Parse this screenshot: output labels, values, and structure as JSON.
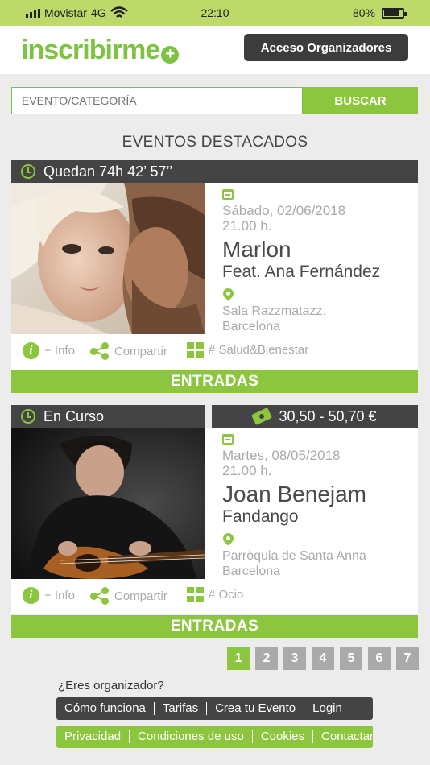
{
  "status_bar": {
    "carrier": "Movistar",
    "network": "4G",
    "time": "22:10",
    "battery": "80%",
    "battery_level": 0.8
  },
  "header": {
    "logo_text": "inscribirme",
    "logo_plus": "+",
    "organizers_button": "Acceso Organizadores"
  },
  "search": {
    "placeholder": "EVENTO/CATEGORÍA",
    "button": "BUSCAR"
  },
  "section_title": "EVENTOS DESTACADOS",
  "events": [
    {
      "status": "Quedan 74h 42’ 57’’",
      "date": "Sábado, 02/06/2018",
      "time": "21.00 h.",
      "artist": "Marlon",
      "subtitle": "Feat. Ana Fernández",
      "venue_line1": "Sala Razzmatazz.",
      "venue_line2": "Barcelona",
      "info_label": "+ Info",
      "share_label": "Compartir",
      "category": "# Salud&Bienestar",
      "tickets_button": "ENTRADAS"
    },
    {
      "status": "En Curso",
      "price": "30,50 - 50,70 €",
      "date": "Martes, 08/05/2018",
      "time": "21.00 h.",
      "artist": "Joan Benejam",
      "subtitle": "Fandango",
      "venue_line1": "Parròquia de Santa Anna",
      "venue_line2": "Barcelona",
      "info_label": "+ Info",
      "share_label": "Compartir",
      "category": "# Ocio",
      "tickets_button": "ENTRADAS"
    }
  ],
  "pagination": {
    "pages": [
      "1",
      "2",
      "3",
      "4",
      "5",
      "6",
      "7"
    ],
    "current": "1"
  },
  "footer": {
    "question": "¿Eres organizador?",
    "dark_links": [
      "Cómo funciona",
      "Tarifas",
      "Crea tu Evento",
      "Login"
    ],
    "green_links": [
      "Privacidad",
      "Condiciones de uso",
      "Cookies",
      "Contactar"
    ]
  },
  "colors": {
    "brand_green": "#8cc63f",
    "dark_bar": "#444444",
    "status_bar": "#bdd96a"
  }
}
